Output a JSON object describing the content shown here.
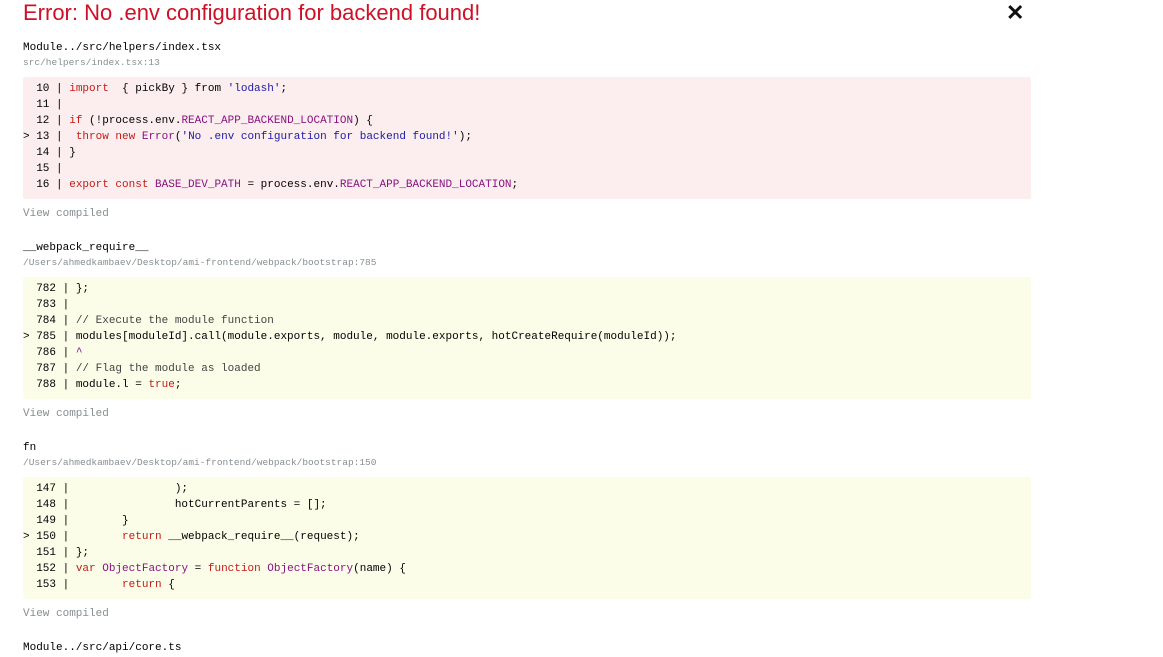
{
  "header": {
    "title": "Error: No .env configuration for backend found!",
    "close_glyph": "✕"
  },
  "frames": [
    {
      "fn_name": "Module../src/helpers/index.tsx",
      "location": "src/helpers/index.tsx:13",
      "view_compiled": "View compiled",
      "background": "#fceeef",
      "lines": [
        {
          "gutter": "  10 | ",
          "segments": [
            [
              "kw",
              "import"
            ],
            [
              "",
              "  { pickBy } from "
            ],
            [
              "str",
              "'lodash'"
            ],
            [
              "",
              ";"
            ]
          ]
        },
        {
          "gutter": "  11 | ",
          "segments": []
        },
        {
          "gutter": "  12 | ",
          "segments": [
            [
              "kw",
              "if"
            ],
            [
              "",
              " (!process.env."
            ],
            [
              "prop",
              "REACT_APP_BACKEND_LOCATION"
            ],
            [
              "",
              ") {"
            ]
          ]
        },
        {
          "gutter": "> 13 | ",
          "arrow": true,
          "segments": [
            [
              "",
              " "
            ],
            [
              "kw",
              "throw new"
            ],
            [
              "",
              " "
            ],
            [
              "prop",
              "Error"
            ],
            [
              "",
              "("
            ],
            [
              "str",
              "'No .env configuration for backend found!'"
            ],
            [
              "",
              ");"
            ]
          ]
        },
        {
          "gutter": "  14 | ",
          "segments": [
            [
              "",
              "}"
            ]
          ]
        },
        {
          "gutter": "  15 | ",
          "segments": []
        },
        {
          "gutter": "  16 | ",
          "segments": [
            [
              "kw",
              "export const"
            ],
            [
              "",
              " "
            ],
            [
              "prop",
              "BASE_DEV_PATH"
            ],
            [
              "",
              " = process.env."
            ],
            [
              "prop",
              "REACT_APP_BACKEND_LOCATION"
            ],
            [
              "",
              ";"
            ]
          ]
        }
      ]
    },
    {
      "fn_name": "__webpack_require__",
      "location": "/Users/ahmedkambaev/Desktop/ami-frontend/webpack/bootstrap:785",
      "view_compiled": "View compiled",
      "background": "#fbfde9",
      "lines": [
        {
          "gutter": "  782 | ",
          "segments": [
            [
              "",
              "};"
            ]
          ]
        },
        {
          "gutter": "  783 | ",
          "segments": []
        },
        {
          "gutter": "  784 | ",
          "segments": [
            [
              "cmt",
              "// Execute the module function"
            ]
          ]
        },
        {
          "gutter": "> 785 | ",
          "arrow": true,
          "segments": [
            [
              "",
              "modules[moduleId].call(module.exports, module, module.exports, hotCreateRequire(moduleId));"
            ]
          ]
        },
        {
          "gutter": "  786 | ",
          "segments": [
            [
              "prop",
              "^"
            ]
          ]
        },
        {
          "gutter": "  787 | ",
          "segments": [
            [
              "cmt",
              "// Flag the module as loaded"
            ]
          ]
        },
        {
          "gutter": "  788 | ",
          "segments": [
            [
              "",
              "module.l = "
            ],
            [
              "kw",
              "true"
            ],
            [
              "",
              ";"
            ]
          ]
        }
      ]
    },
    {
      "fn_name": "fn",
      "location": "/Users/ahmedkambaev/Desktop/ami-frontend/webpack/bootstrap:150",
      "view_compiled": "View compiled",
      "background": "#fbfde9",
      "lines": [
        {
          "gutter": "  147 | ",
          "segments": [
            [
              "",
              "               );"
            ]
          ]
        },
        {
          "gutter": "  148 | ",
          "segments": [
            [
              "",
              "               hotCurrentParents = [];"
            ]
          ]
        },
        {
          "gutter": "  149 | ",
          "segments": [
            [
              "",
              "       }"
            ]
          ]
        },
        {
          "gutter": "> 150 | ",
          "arrow": true,
          "segments": [
            [
              "",
              "       "
            ],
            [
              "kw",
              "return"
            ],
            [
              "",
              " __webpack_require__(request);"
            ]
          ]
        },
        {
          "gutter": "  151 | ",
          "segments": [
            [
              "",
              "};"
            ]
          ]
        },
        {
          "gutter": "  152 | ",
          "segments": [
            [
              "kw",
              "var"
            ],
            [
              "",
              " "
            ],
            [
              "prop",
              "ObjectFactory"
            ],
            [
              "",
              " = "
            ],
            [
              "kw",
              "function"
            ],
            [
              "",
              " "
            ],
            [
              "prop",
              "ObjectFactory"
            ],
            [
              "",
              "(name) {"
            ]
          ]
        },
        {
          "gutter": "  153 | ",
          "segments": [
            [
              "",
              "       "
            ],
            [
              "kw",
              "return"
            ],
            [
              "",
              " {"
            ]
          ]
        }
      ]
    }
  ],
  "next_frame": {
    "fn_name": "Module../src/api/core.ts"
  }
}
